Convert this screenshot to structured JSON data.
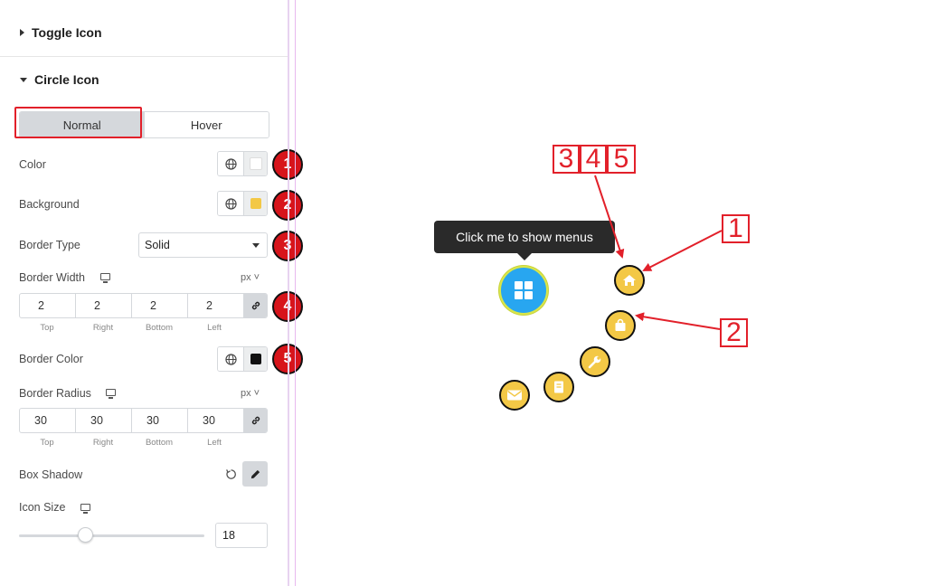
{
  "panel": {
    "toggle_icon_title": "Toggle Icon",
    "circle_icon_title": "Circle Icon",
    "tabs": [
      {
        "label": "Normal",
        "active": true
      },
      {
        "label": "Hover",
        "active": false
      }
    ],
    "color_label": "Color",
    "background_label": "Background",
    "border_type_label": "Border Type",
    "border_type_value": "Solid",
    "border_width_label": "Border Width",
    "border_width_unit": "px",
    "border_width_values": [
      "2",
      "2",
      "2",
      "2"
    ],
    "dimension_labels": [
      "Top",
      "Right",
      "Bottom",
      "Left"
    ],
    "border_color_label": "Border Color",
    "border_radius_label": "Border Radius",
    "border_radius_unit": "px",
    "border_radius_values": [
      "30",
      "30",
      "30",
      "30"
    ],
    "box_shadow_label": "Box Shadow",
    "icon_size_label": "Icon Size",
    "icon_size_value": "18",
    "icon_size_slider_fraction": 0.36,
    "colors": {
      "color_swatch": "#ffffff",
      "background_swatch": "#f3c846",
      "border_color_swatch": "#111111"
    }
  },
  "badges": [
    "1",
    "2",
    "3",
    "4",
    "5"
  ],
  "preview": {
    "tooltip": "Click me to show menus",
    "toggle_icon": "windows-grid-icon",
    "menu_items": [
      {
        "icon": "home-icon"
      },
      {
        "icon": "shopping-bag-icon"
      },
      {
        "icon": "wrench-icon"
      },
      {
        "icon": "book-icon"
      },
      {
        "icon": "envelope-icon"
      }
    ],
    "annotations": {
      "label_1": "1",
      "label_2": "2",
      "label_345": [
        "3",
        "4",
        "5"
      ]
    }
  },
  "accent": {
    "annotation_red": "#e2202a",
    "toggle_blue": "#28a6f0",
    "menu_yellow": "#f3c846"
  }
}
